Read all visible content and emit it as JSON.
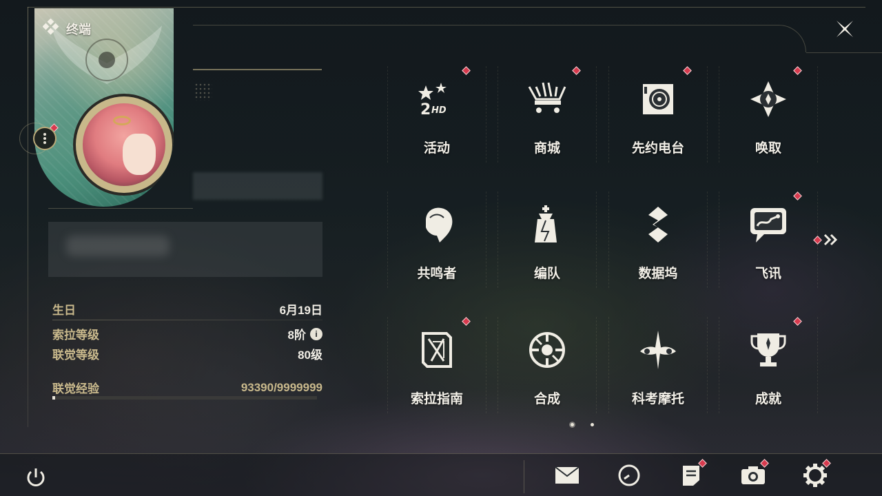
{
  "header": {
    "title": "终端"
  },
  "profile": {
    "stats": [
      {
        "label": "生日",
        "value": "6月19日"
      },
      {
        "label": "索拉等级",
        "value": "8阶"
      },
      {
        "label": "联觉等级",
        "value": "80级"
      }
    ],
    "exp": {
      "label": "联觉经验",
      "value": "93390/9999999",
      "progress": 0.0093
    }
  },
  "grid": {
    "tiles": [
      {
        "label": "活动",
        "icon": "event-2hd-icon",
        "badge": true
      },
      {
        "label": "商城",
        "icon": "shop-cart-icon",
        "badge": true
      },
      {
        "label": "先约电台",
        "icon": "radio-icon",
        "badge": true
      },
      {
        "label": "唤取",
        "icon": "convene-compass-icon",
        "badge": true
      },
      {
        "label": "共鸣者",
        "icon": "resonator-icon",
        "badge": false
      },
      {
        "label": "编队",
        "icon": "team-chess-icon",
        "badge": false
      },
      {
        "label": "数据坞",
        "icon": "data-bank-icon",
        "badge": false
      },
      {
        "label": "飞讯",
        "icon": "chat-icon",
        "badge": true
      },
      {
        "label": "索拉指南",
        "icon": "guide-book-icon",
        "badge": true
      },
      {
        "label": "合成",
        "icon": "synthesis-icon",
        "badge": false
      },
      {
        "label": "科考摩托",
        "icon": "motorbike-icon",
        "badge": false
      },
      {
        "label": "成就",
        "icon": "trophy-icon",
        "badge": true
      }
    ],
    "pages": 2
  },
  "bottom_bar": {
    "items": [
      {
        "name": "power-icon",
        "badge": false
      },
      {
        "name": "mail-icon",
        "badge": false
      },
      {
        "name": "clock-icon",
        "badge": false
      },
      {
        "name": "notice-icon",
        "badge": true
      },
      {
        "name": "camera-icon",
        "badge": true
      },
      {
        "name": "settings-gear-icon",
        "badge": true
      }
    ]
  },
  "colors": {
    "accent_gold": "#c9b98c",
    "badge_red": "#d83a4e",
    "text_light": "#f3f0e8"
  }
}
